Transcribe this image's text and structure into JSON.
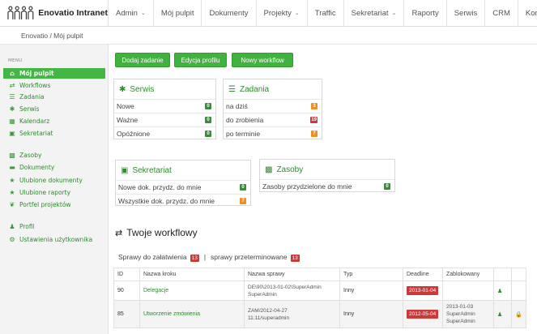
{
  "brand": {
    "name": "Enovatio Intranet",
    "logo_icon": "people-logo-icon"
  },
  "topnav": [
    {
      "label": "Admin",
      "dropdown": true
    },
    {
      "label": "Mój pulpit",
      "dropdown": false
    },
    {
      "label": "Dokumenty",
      "dropdown": false
    },
    {
      "label": "Projekty",
      "dropdown": true
    },
    {
      "label": "Traffic",
      "dropdown": false
    },
    {
      "label": "Sekretariat",
      "dropdown": true
    },
    {
      "label": "Raporty",
      "dropdown": false
    },
    {
      "label": "Serwis",
      "dropdown": false
    },
    {
      "label": "CRM",
      "dropdown": false
    },
    {
      "label": "Kontakty",
      "dropdown": false
    }
  ],
  "breadcrumb": "Enovatio / Mój pulpit",
  "sidebar": {
    "menu_label": "MENU",
    "items": [
      {
        "label": "Mój pulpit",
        "icon": "home-icon",
        "active": true
      },
      {
        "label": "Workflows",
        "icon": "shuffle-icon"
      },
      {
        "label": "Zadania",
        "icon": "tasks-icon"
      },
      {
        "label": "Serwis",
        "icon": "asterisk-icon"
      },
      {
        "label": "Kalendarz",
        "icon": "calendar-icon"
      },
      {
        "label": "Sekretariat",
        "icon": "inbox-icon"
      },
      {
        "label": "Zasoby",
        "icon": "truck-icon"
      },
      {
        "label": "Dokumenty",
        "icon": "folder-icon"
      },
      {
        "label": "Ulubione dokumenty",
        "icon": "star-icon"
      },
      {
        "label": "Ulubione raporty",
        "icon": "star-icon"
      },
      {
        "label": "Portfel projektów",
        "icon": "leaf-icon"
      },
      {
        "label": "Profil",
        "icon": "user-icon"
      },
      {
        "label": "Ustawienia użytkownika",
        "icon": "cogs-icon"
      }
    ]
  },
  "buttons": {
    "add_task": "Dodaj zadanie",
    "edit_profile": "Edycja profilu",
    "new_workflow": "Nowy workflow"
  },
  "widgets": {
    "serwis": {
      "title": "Serwis",
      "rows": [
        {
          "label": "Nowe",
          "count": "0",
          "color": "#3c8a3c"
        },
        {
          "label": "Ważne",
          "count": "0",
          "color": "#3c8a3c"
        },
        {
          "label": "Opóźnione",
          "count": "0",
          "color": "#3c8a3c"
        }
      ]
    },
    "zadania": {
      "title": "Zadania",
      "rows": [
        {
          "label": "na dziś",
          "count": "3",
          "color": "#ef8f21"
        },
        {
          "label": "do zrobienia",
          "count": "19",
          "color": "#c93a3a"
        },
        {
          "label": "po terminie",
          "count": "7",
          "color": "#ef8f21"
        }
      ]
    },
    "sekretariat": {
      "title": "Sekretariat",
      "rows": [
        {
          "label": "Nowe dok. przydz. do mnie",
          "count": "0",
          "color": "#3c8a3c"
        },
        {
          "label": "Wszystkie dok. przydz. do mnie",
          "count": "7",
          "color": "#ef8f21"
        }
      ]
    },
    "zasoby": {
      "title": "Zasoby",
      "rows": [
        {
          "label": "Zasoby przydzielone do mnie",
          "count": "0",
          "color": "#3c8a3c"
        }
      ]
    }
  },
  "workflows": {
    "title": "Twoje workflowy",
    "tab_pending": "Sprawy do załatwienia",
    "tab_pending_count": "13",
    "tab_overdue": "sprawy przeterminowane",
    "tab_overdue_count": "13",
    "columns": [
      "ID",
      "Nazwa kroku",
      "Nazwa sprawy",
      "Typ",
      "Deadline",
      "Zablokowany"
    ],
    "rows": [
      {
        "id": "90",
        "step": "Delegacje",
        "case_line1": "DE\\90\\2013-01-02\\SuperAdmin",
        "case_line2": "SuperAdmin",
        "type": "Inny",
        "deadline": "2013-01-04",
        "locked_line1": "",
        "locked_line2": "",
        "locked_line3": ""
      },
      {
        "id": "85",
        "step": "Utworzenie zmówienia",
        "case_line1": "ZAM/2012-04-27",
        "case_line2": "11:11/superadmin",
        "type": "Inny",
        "deadline": "2012-05-04",
        "locked_line1": "2013-01-03",
        "locked_line2": "SuperAdmin",
        "locked_line3": "SuperAdmin"
      }
    ]
  }
}
